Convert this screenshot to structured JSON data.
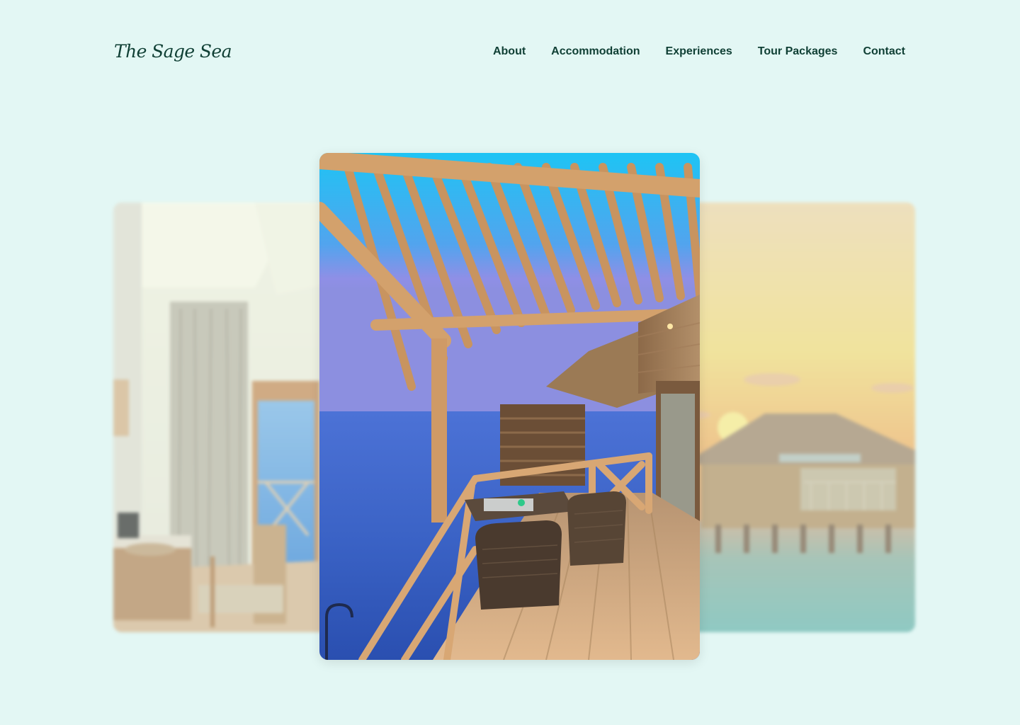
{
  "brand": {
    "name": "The Sage Sea"
  },
  "nav": {
    "items": [
      {
        "label": "About"
      },
      {
        "label": "Accommodation"
      },
      {
        "label": "Experiences"
      },
      {
        "label": "Tour Packages"
      },
      {
        "label": "Contact"
      }
    ]
  },
  "carousel": {
    "slides": [
      {
        "position": "previous",
        "scene": "villa-bedroom-interior"
      },
      {
        "position": "active",
        "scene": "overwater-villa-deck-at-dusk"
      },
      {
        "position": "next",
        "scene": "overwater-bungalow-at-sunset"
      }
    ]
  },
  "colors": {
    "background": "#e3f7f4",
    "text": "#0f3f34"
  }
}
